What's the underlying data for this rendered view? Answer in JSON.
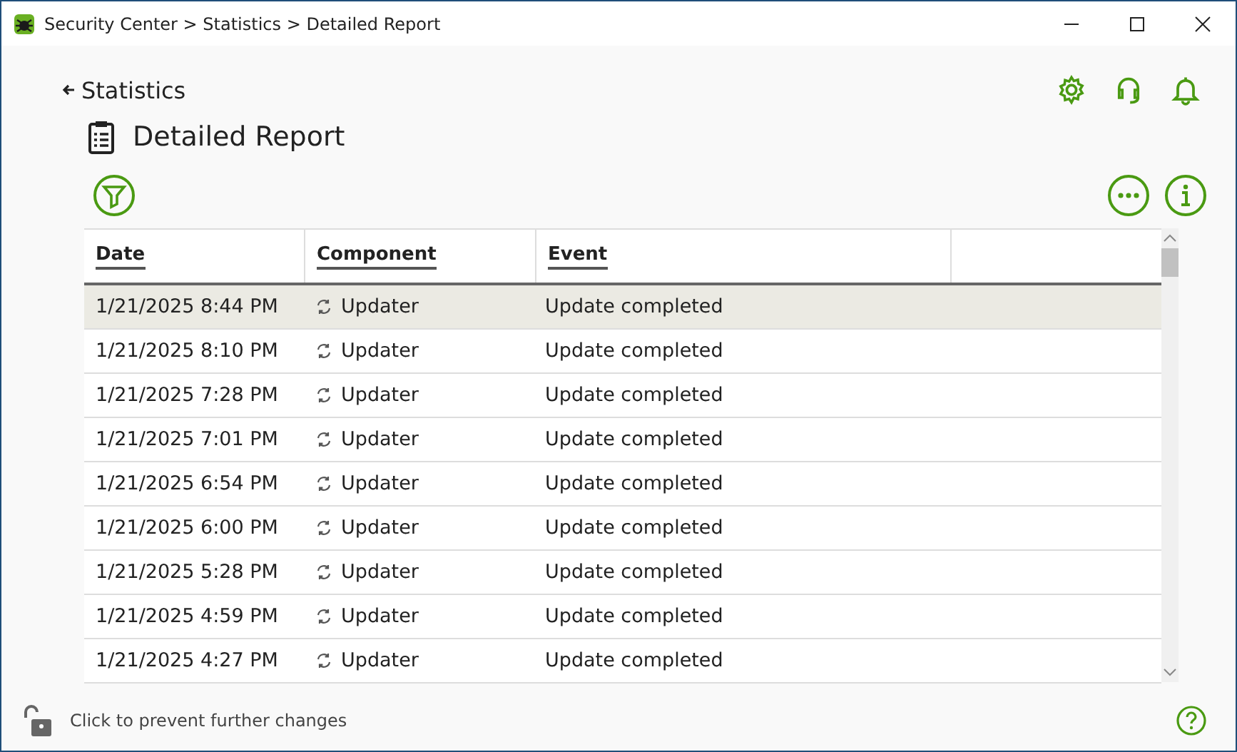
{
  "window": {
    "title": "Security Center > Statistics > Detailed Report"
  },
  "back_link": "Statistics",
  "page_title": "Detailed Report",
  "table": {
    "columns": [
      "Date",
      "Component",
      "Event"
    ],
    "rows": [
      {
        "date": "1/21/2025 8:44 PM",
        "component": "Updater",
        "event": "Update completed",
        "selected": true
      },
      {
        "date": "1/21/2025 8:10 PM",
        "component": "Updater",
        "event": "Update completed",
        "selected": false
      },
      {
        "date": "1/21/2025 7:28 PM",
        "component": "Updater",
        "event": "Update completed",
        "selected": false
      },
      {
        "date": "1/21/2025 7:01 PM",
        "component": "Updater",
        "event": "Update completed",
        "selected": false
      },
      {
        "date": "1/21/2025 6:54 PM",
        "component": "Updater",
        "event": "Update completed",
        "selected": false
      },
      {
        "date": "1/21/2025 6:00 PM",
        "component": "Updater",
        "event": "Update completed",
        "selected": false
      },
      {
        "date": "1/21/2025 5:28 PM",
        "component": "Updater",
        "event": "Update completed",
        "selected": false
      },
      {
        "date": "1/21/2025 4:59 PM",
        "component": "Updater",
        "event": "Update completed",
        "selected": false
      },
      {
        "date": "1/21/2025 4:27 PM",
        "component": "Updater",
        "event": "Update completed",
        "selected": false
      }
    ]
  },
  "status_bar": {
    "lock_text": "Click to prevent further changes"
  }
}
